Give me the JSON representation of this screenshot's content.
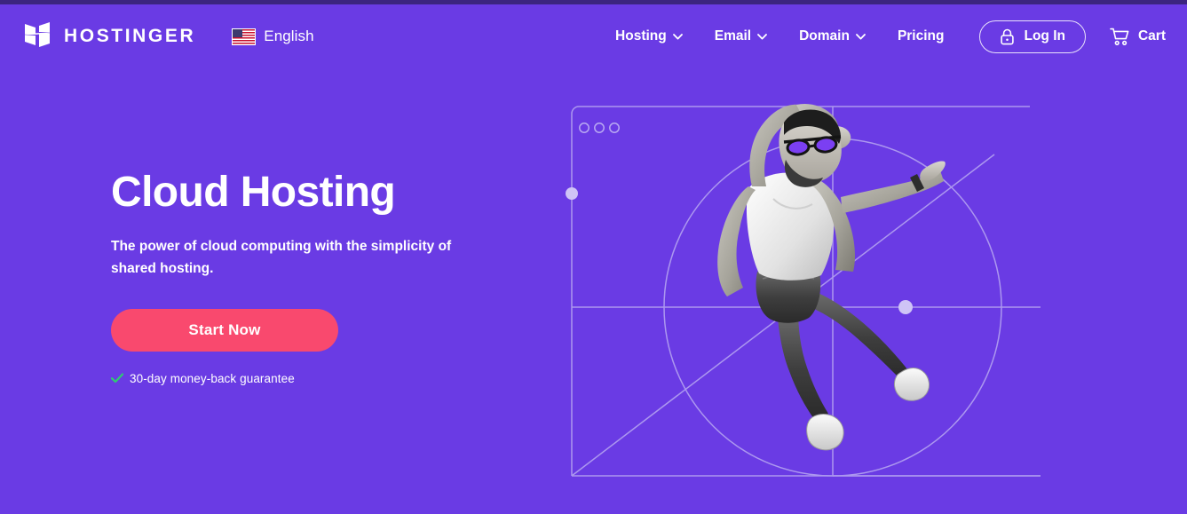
{
  "theme": {
    "background": "#6A3BE4",
    "top_strip": "#3C2580",
    "cta_pink": "#F9496E",
    "check_green": "#2ECC71",
    "text_white": "#FFFFFF",
    "line_color": "#B8A8F2"
  },
  "header": {
    "brand": {
      "logo_icon": "hostinger-h-logo",
      "wordmark": "HOSTINGER"
    },
    "language": {
      "flag_icon": "flag-us-icon",
      "label": "English"
    },
    "nav": [
      {
        "label": "Hosting",
        "has_dropdown": true
      },
      {
        "label": "Email",
        "has_dropdown": true
      },
      {
        "label": "Domain",
        "has_dropdown": true
      },
      {
        "label": "Pricing",
        "has_dropdown": false
      }
    ],
    "login": {
      "label": "Log In",
      "icon": "lock-icon"
    },
    "cart": {
      "label": "Cart",
      "icon": "shopping-cart-icon"
    }
  },
  "hero": {
    "title": "Cloud Hosting",
    "subtitle": "The power of cloud computing with the simplicity of shared hosting.",
    "cta_label": "Start Now",
    "guarantee": {
      "icon": "check-icon",
      "text": "30-day money-back guarantee"
    }
  },
  "illustration": {
    "alt": "Man in grayscale jumping in front of a browser window outline with geometric guide lines",
    "browser_dots": 3
  }
}
